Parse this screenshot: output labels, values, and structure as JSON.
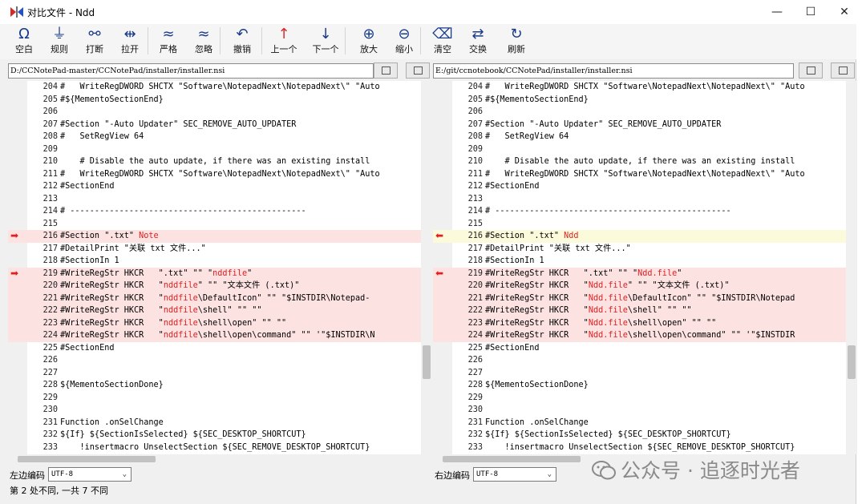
{
  "window": {
    "title": "对比文件 - Ndd"
  },
  "toolbar": [
    {
      "icon": "omega-icon",
      "glyph": "Ω",
      "label": "空白"
    },
    {
      "icon": "rule-icon",
      "glyph": "⏚",
      "label": "规则"
    },
    {
      "icon": "break-icon",
      "glyph": "⚯",
      "label": "打断"
    },
    {
      "icon": "stretch-icon",
      "glyph": "⇹",
      "label": "拉开"
    },
    {
      "icon": "strict-icon",
      "glyph": "≈",
      "label": "严格"
    },
    {
      "icon": "ignore-icon",
      "glyph": "≈",
      "label": "忽略"
    },
    {
      "icon": "undo-icon",
      "glyph": "↶",
      "label": "撤销"
    },
    {
      "icon": "prev-diff-icon",
      "glyph": "↑",
      "label": "上一个"
    },
    {
      "icon": "next-diff-icon",
      "glyph": "↓",
      "label": "下一个"
    },
    {
      "icon": "zoom-in-icon",
      "glyph": "⊕",
      "label": "放大"
    },
    {
      "icon": "zoom-out-icon",
      "glyph": "⊖",
      "label": "缩小"
    },
    {
      "icon": "clear-icon",
      "glyph": "⌫",
      "label": "清空"
    },
    {
      "icon": "swap-icon",
      "glyph": "⇄",
      "label": "交换"
    },
    {
      "icon": "refresh-icon",
      "glyph": "↻",
      "label": "刷新"
    }
  ],
  "left": {
    "path": "D:/CCNotePad-master/CCNotePad/installer/installer.nsi",
    "lines": [
      {
        "n": "204",
        "t": "#   WriteRegDWORD SHCTX \"Software\\NotepadNext\\NotepadNext\\\" \"Auto",
        "d": ""
      },
      {
        "n": "205",
        "t": "#${MementoSectionEnd}",
        "d": ""
      },
      {
        "n": "206",
        "t": "",
        "d": ""
      },
      {
        "n": "207",
        "t": "#Section \"-Auto Updater\" SEC_REMOVE_AUTO_UPDATER",
        "d": ""
      },
      {
        "n": "208",
        "t": "#   SetRegView 64",
        "d": ""
      },
      {
        "n": "209",
        "t": "",
        "d": ""
      },
      {
        "n": "210",
        "t": "    # Disable the auto update, if there was an existing install",
        "d": ""
      },
      {
        "n": "211",
        "t": "#   WriteRegDWORD SHCTX \"Software\\NotepadNext\\NotepadNext\\\" \"Auto",
        "d": ""
      },
      {
        "n": "212",
        "t": "#SectionEnd",
        "d": ""
      },
      {
        "n": "213",
        "t": "",
        "d": ""
      },
      {
        "n": "214",
        "t": "# ------------------------------------------------",
        "d": ""
      },
      {
        "n": "215",
        "t": "",
        "d": ""
      },
      {
        "n": "216",
        "t": "#Section \".txt\" ",
        "h": "Note",
        "d": "red"
      },
      {
        "n": "217",
        "t": "#DetailPrint \"关联 txt 文件...\"",
        "d": ""
      },
      {
        "n": "218",
        "t": "#SectionIn 1",
        "d": ""
      },
      {
        "n": "219",
        "t": "#WriteRegStr HKCR   \".txt\" \"\" \"",
        "h": "nddfile",
        "t2": "\"",
        "d": "red"
      },
      {
        "n": "220",
        "t": "#WriteRegStr HKCR   \"",
        "h": "nddfile",
        "t2": "\" \"\" \"文本文件 (.txt)\"",
        "d": "red"
      },
      {
        "n": "221",
        "t": "#WriteRegStr HKCR   \"",
        "h": "nddfile",
        "t2": "\\DefaultIcon\" \"\" \"$INSTDIR\\Notepad-",
        "d": "red"
      },
      {
        "n": "222",
        "t": "#WriteRegStr HKCR   \"",
        "h": "nddfile",
        "t2": "\\shell\" \"\" \"\"",
        "d": "red"
      },
      {
        "n": "223",
        "t": "#WriteRegStr HKCR   \"",
        "h": "nddfile",
        "t2": "\\shell\\open\" \"\" \"\"",
        "d": "red"
      },
      {
        "n": "224",
        "t": "#WriteRegStr HKCR   \"",
        "h": "nddfile",
        "t2": "\\shell\\open\\command\" \"\" '\"$INSTDIR\\N",
        "d": "red"
      },
      {
        "n": "225",
        "t": "#SectionEnd",
        "d": ""
      },
      {
        "n": "226",
        "t": "",
        "d": ""
      },
      {
        "n": "227",
        "t": "",
        "d": ""
      },
      {
        "n": "228",
        "t": "${MementoSectionDone}",
        "d": ""
      },
      {
        "n": "229",
        "t": "",
        "d": ""
      },
      {
        "n": "230",
        "t": "",
        "d": ""
      },
      {
        "n": "231",
        "t": "Function .onSelChange",
        "d": ""
      },
      {
        "n": "232",
        "t": "${If} ${SectionIsSelected} ${SEC_DESKTOP_SHORTCUT}",
        "d": ""
      },
      {
        "n": "233",
        "t": "    !insertmacro UnselectSection ${SEC_REMOVE_DESKTOP_SHORTCUT}",
        "d": ""
      }
    ]
  },
  "right": {
    "path": "E:/git/ccnotebook/CCNotePad/installer/installer.nsi",
    "lines": [
      {
        "n": "204",
        "t": "#   WriteRegDWORD SHCTX \"Software\\NotepadNext\\NotepadNext\\\" \"Auto",
        "d": ""
      },
      {
        "n": "205",
        "t": "#${MementoSectionEnd}",
        "d": ""
      },
      {
        "n": "206",
        "t": "",
        "d": ""
      },
      {
        "n": "207",
        "t": "#Section \"-Auto Updater\" SEC_REMOVE_AUTO_UPDATER",
        "d": ""
      },
      {
        "n": "208",
        "t": "#   SetRegView 64",
        "d": ""
      },
      {
        "n": "209",
        "t": "",
        "d": ""
      },
      {
        "n": "210",
        "t": "    # Disable the auto update, if there was an existing install",
        "d": ""
      },
      {
        "n": "211",
        "t": "#   WriteRegDWORD SHCTX \"Software\\NotepadNext\\NotepadNext\\\" \"Auto",
        "d": ""
      },
      {
        "n": "212",
        "t": "#SectionEnd",
        "d": ""
      },
      {
        "n": "213",
        "t": "",
        "d": ""
      },
      {
        "n": "214",
        "t": "# ------------------------------------------------",
        "d": ""
      },
      {
        "n": "215",
        "t": "",
        "d": ""
      },
      {
        "n": "216",
        "t": "#Section \".txt\" ",
        "h": "Ndd",
        "d": "yel"
      },
      {
        "n": "217",
        "t": "#DetailPrint \"关联 txt 文件...\"",
        "d": ""
      },
      {
        "n": "218",
        "t": "#SectionIn 1",
        "d": ""
      },
      {
        "n": "219",
        "t": "#WriteRegStr HKCR   \".txt\" \"\" \"",
        "h": "Ndd.file",
        "t2": "\"",
        "d": "red"
      },
      {
        "n": "220",
        "t": "#WriteRegStr HKCR   \"",
        "h": "Ndd.file",
        "t2": "\" \"\" \"文本文件 (.txt)\"",
        "d": "red"
      },
      {
        "n": "221",
        "t": "#WriteRegStr HKCR   \"",
        "h": "Ndd.file",
        "t2": "\\DefaultIcon\" \"\" \"$INSTDIR\\Notepad",
        "d": "red"
      },
      {
        "n": "222",
        "t": "#WriteRegStr HKCR   \"",
        "h": "Ndd.file",
        "t2": "\\shell\" \"\" \"\"",
        "d": "red"
      },
      {
        "n": "223",
        "t": "#WriteRegStr HKCR   \"",
        "h": "Ndd.file",
        "t2": "\\shell\\open\" \"\" \"\"",
        "d": "red"
      },
      {
        "n": "224",
        "t": "#WriteRegStr HKCR   \"",
        "h": "Ndd.file",
        "t2": "\\shell\\open\\command\" \"\" '\"$INSTDIR",
        "d": "red"
      },
      {
        "n": "225",
        "t": "#SectionEnd",
        "d": ""
      },
      {
        "n": "226",
        "t": "",
        "d": ""
      },
      {
        "n": "227",
        "t": "",
        "d": ""
      },
      {
        "n": "228",
        "t": "${MementoSectionDone}",
        "d": ""
      },
      {
        "n": "229",
        "t": "",
        "d": ""
      },
      {
        "n": "230",
        "t": "",
        "d": ""
      },
      {
        "n": "231",
        "t": "Function .onSelChange",
        "d": ""
      },
      {
        "n": "232",
        "t": "${If} ${SectionIsSelected} ${SEC_DESKTOP_SHORTCUT}",
        "d": ""
      },
      {
        "n": "233",
        "t": "    !insertmacro UnselectSection ${SEC_REMOVE_DESKTOP_SHORTCUT}",
        "d": ""
      }
    ]
  },
  "encoding": {
    "left_label": "左边编码",
    "left_value": "UTF-8",
    "right_label": "右边编码",
    "right_value": "UTF-8"
  },
  "status": "第 2 处不同, 一共 7 不同",
  "watermark": "公众号 · 追逐时光者",
  "colors": {
    "diff_red": "#fde2e2",
    "diff_yellow": "#fbfbdc",
    "highlight": "#e02020"
  }
}
